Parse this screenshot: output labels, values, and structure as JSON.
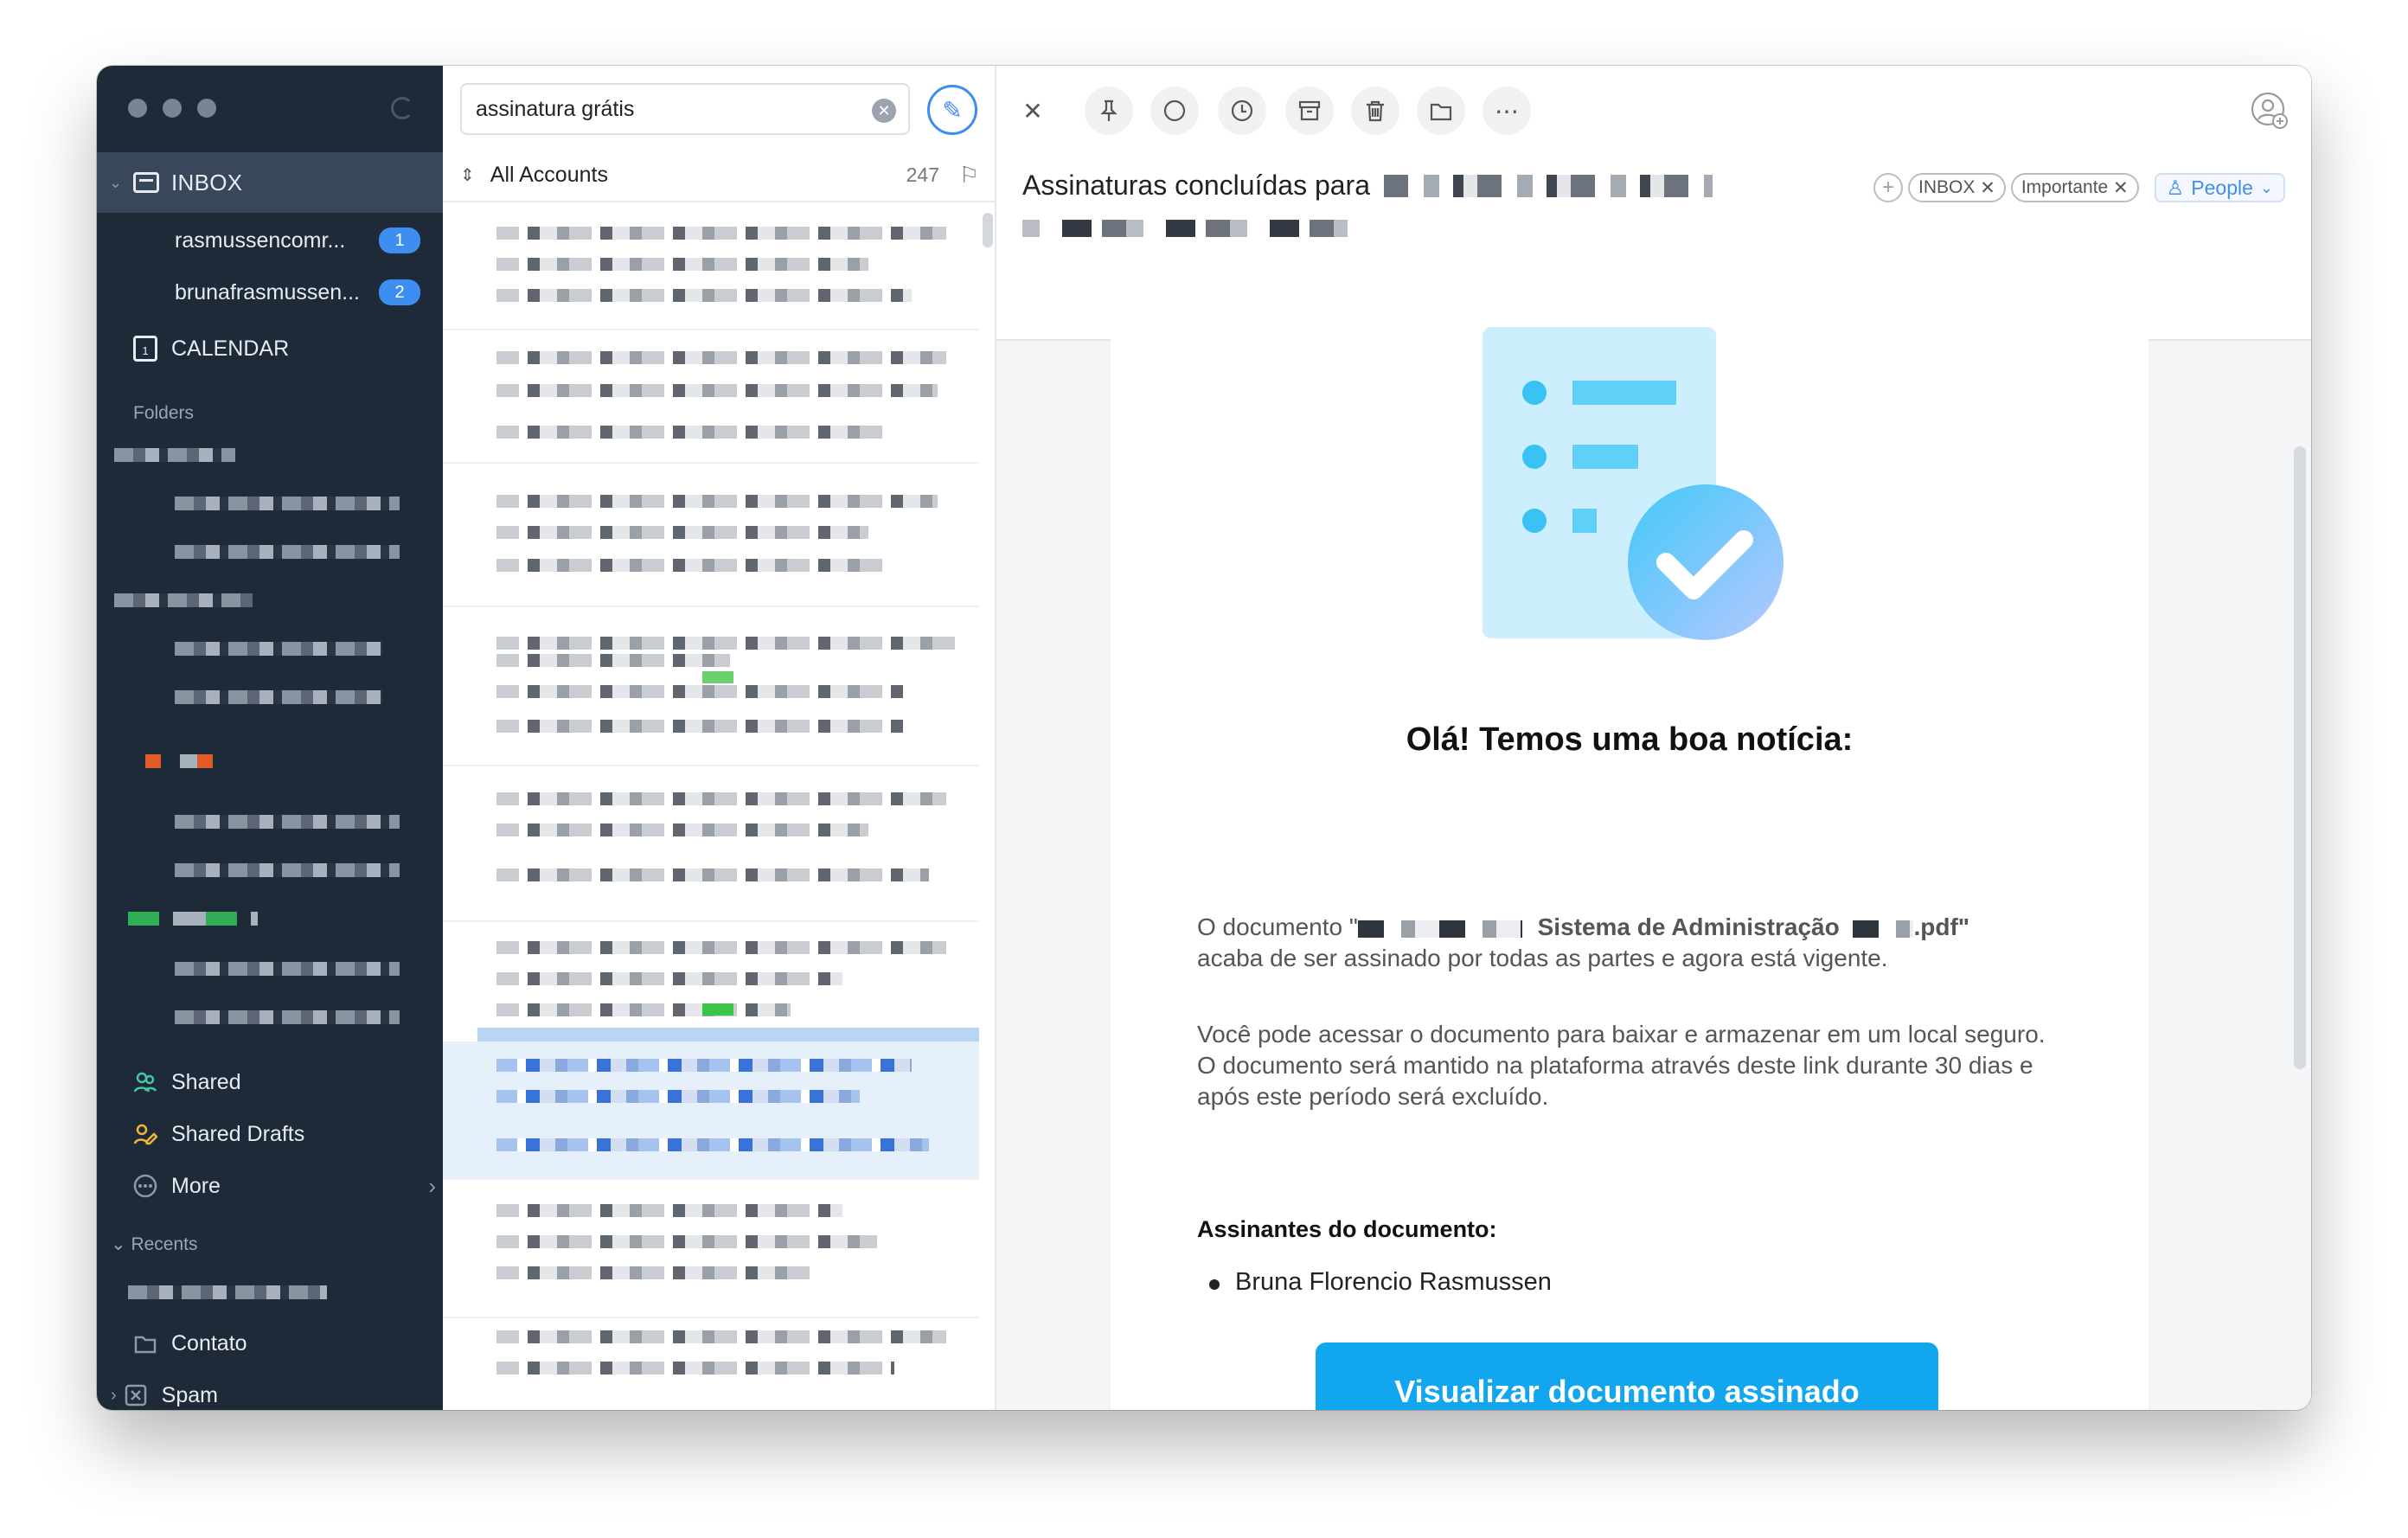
{
  "sidebar": {
    "inbox_label": "INBOX",
    "accounts": [
      {
        "name": "rasmussencomr...",
        "count": "1"
      },
      {
        "name": "brunafrasmussen...",
        "count": "2"
      }
    ],
    "calendar_label": "CALENDAR",
    "folders_heading": "Folders",
    "shared_label": "Shared",
    "shared_drafts_label": "Shared Drafts",
    "more_label": "More",
    "recents_heading": "Recents",
    "contato_label": "Contato",
    "spam_label": "Spam"
  },
  "list": {
    "search_value": "assinatura grátis",
    "account_filter": "All Accounts",
    "count": "247"
  },
  "message": {
    "subject": "Assinaturas concluídas para",
    "tags": [
      "INBOX",
      "Importante"
    ],
    "people_label": "People",
    "greeting": "Olá! Temos uma boa notícia:",
    "doc_prefix": "O documento \"",
    "doc_name_visible": "Sistema de Administração",
    "doc_suffix": ".pdf\"",
    "doc_line2": "acaba de ser assinado por todas as partes e agora está vigente.",
    "access_text": "Você pode acessar o documento para baixar e armazenar em um local seguro. O documento será mantido na plataforma através deste link durante 30 dias e após este período será excluído.",
    "signers_heading": "Assinantes do documento:",
    "signer_name": "Bruna Florencio Rasmussen",
    "cta_label": "Visualizar documento assinado"
  },
  "colors": {
    "sidebar_bg": "#1f2a38",
    "accent": "#3e8ef1",
    "cta": "#12a6ef"
  }
}
